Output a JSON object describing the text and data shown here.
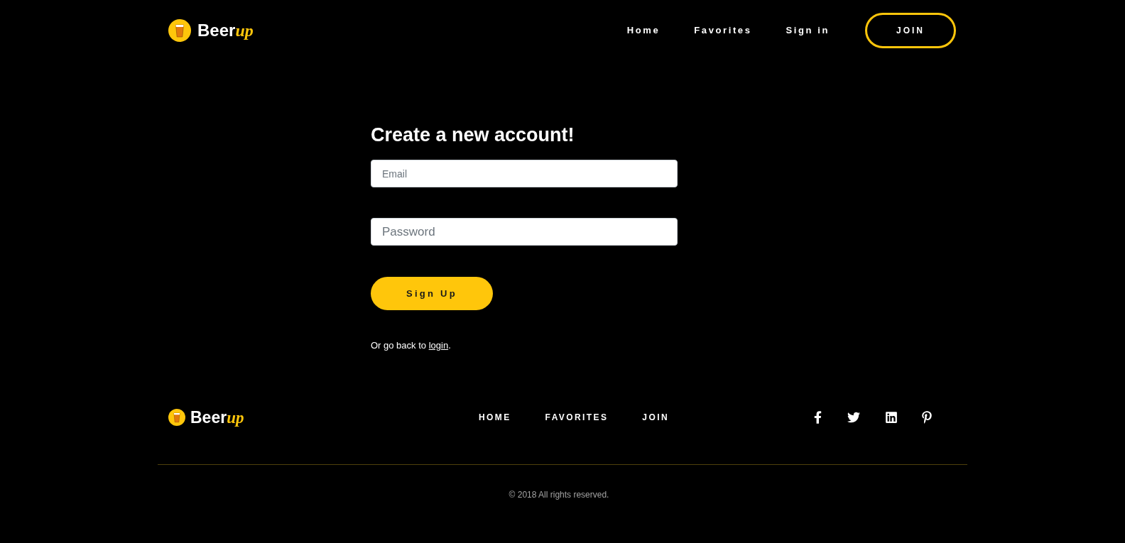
{
  "header": {
    "logo": {
      "word": "Beer",
      "accent": "up"
    },
    "nav": [
      {
        "label": "Home"
      },
      {
        "label": "Favorites"
      },
      {
        "label": "Sign in"
      }
    ],
    "join_button": "JOIN"
  },
  "form": {
    "title": "Create a new account!",
    "fields": [
      {
        "kind": "email",
        "placeholder": "Email"
      },
      {
        "kind": "password",
        "placeholder": "Password"
      }
    ],
    "submit": "Sign Up",
    "footnote": {
      "before": "Or go back to ",
      "link": "login",
      "after": "."
    }
  },
  "footer": {
    "logo": {
      "word": "Beer",
      "accent": "up"
    },
    "nav": [
      {
        "label": "HOME"
      },
      {
        "label": "FAVORITES"
      },
      {
        "label": "JOIN"
      }
    ],
    "copyright": "© 2018 All rights reserved."
  }
}
